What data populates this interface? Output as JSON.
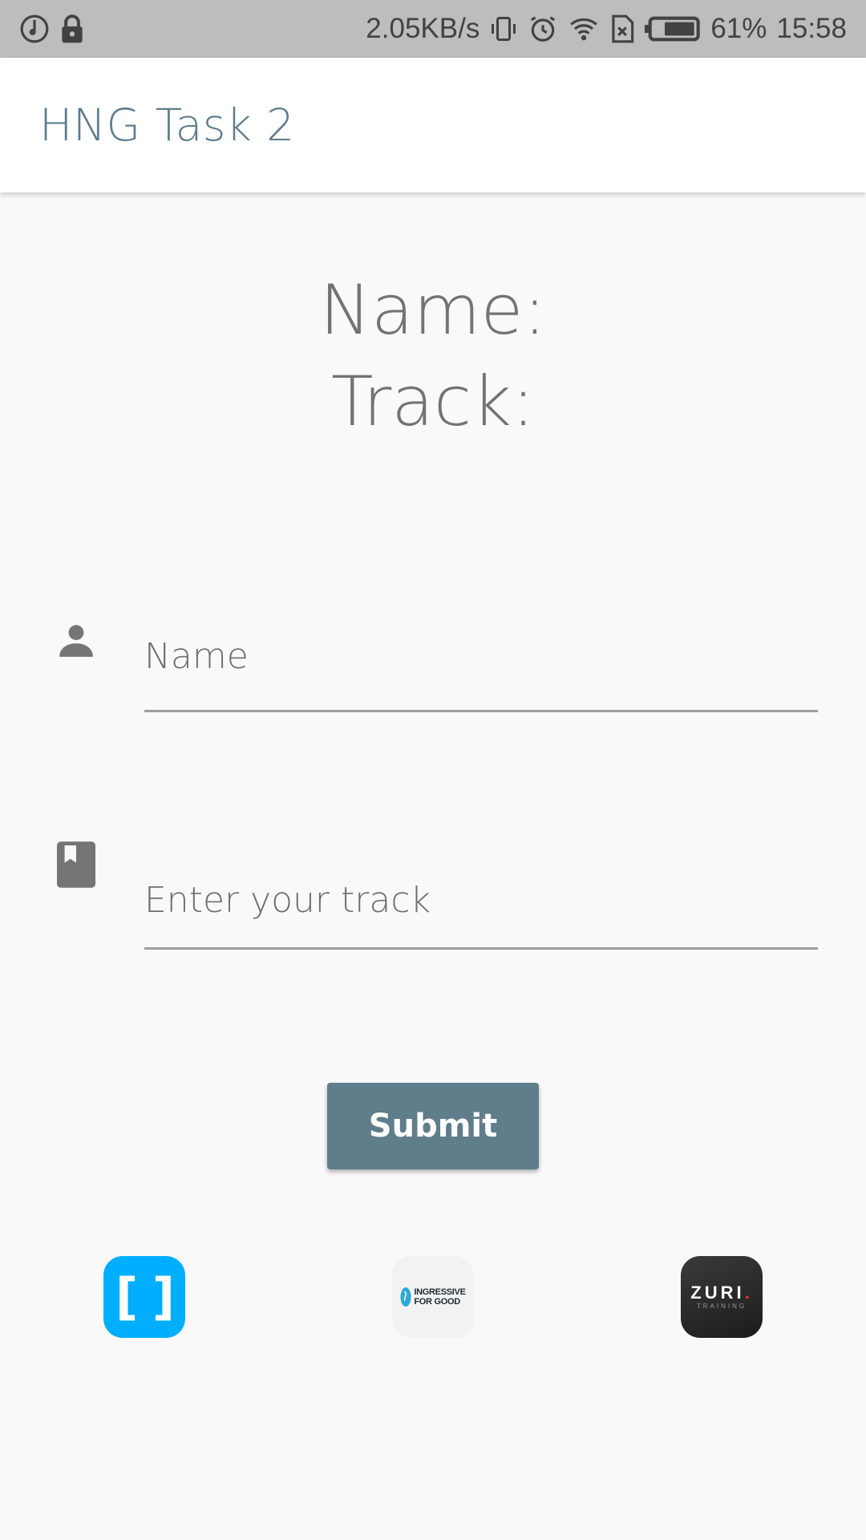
{
  "status_bar": {
    "network_speed": "2.05KB/s",
    "battery": "61%",
    "time": "15:58",
    "icons": [
      "music-note-icon",
      "lock-icon",
      "vibrate-icon",
      "alarm-icon",
      "wifi-icon",
      "sim-icon",
      "battery-icon"
    ]
  },
  "app_bar": {
    "title": "HNG Task 2",
    "title_color": "#5e7c8c"
  },
  "info": {
    "name_label": "Name:",
    "track_label": "Track:"
  },
  "form": {
    "name_placeholder": "Name",
    "name_icon": "person-icon",
    "track_placeholder": "Enter your track",
    "track_icon": "book-icon",
    "submit_label": "Submit",
    "submit_color": "#607d8b"
  },
  "logos": {
    "hng": {
      "mark": "[ ]",
      "color": "#00aeff"
    },
    "i4g": {
      "line1": "INGRESSIVE",
      "line2": "FOR GOOD"
    },
    "zuri": {
      "name": "ZURI",
      "dot": ".",
      "sub": "TRAINING"
    }
  }
}
